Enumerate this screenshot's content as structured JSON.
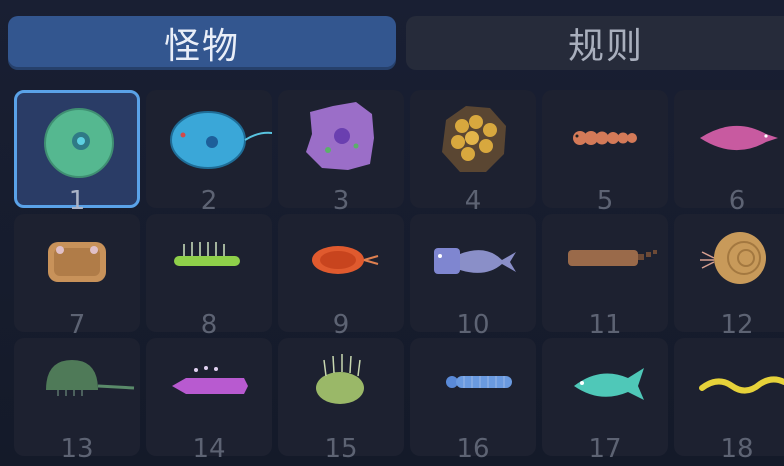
{
  "tabs": {
    "monsters_label": "怪物",
    "rules_label": "规则"
  },
  "cards": [
    {
      "number": "1",
      "icon": "green-cell-icon",
      "selected": true
    },
    {
      "number": "2",
      "icon": "blue-flagellate-icon",
      "selected": false
    },
    {
      "number": "3",
      "icon": "purple-amoeba-icon",
      "selected": false
    },
    {
      "number": "4",
      "icon": "egg-cluster-icon",
      "selected": false
    },
    {
      "number": "5",
      "icon": "segmented-worm-icon",
      "selected": false
    },
    {
      "number": "6",
      "icon": "pink-fish-icon",
      "selected": false
    },
    {
      "number": "7",
      "icon": "trilobite-icon",
      "selected": false
    },
    {
      "number": "8",
      "icon": "spiny-worm-icon",
      "selected": false
    },
    {
      "number": "9",
      "icon": "red-crustacean-icon",
      "selected": false
    },
    {
      "number": "10",
      "icon": "armored-fish-icon",
      "selected": false
    },
    {
      "number": "11",
      "icon": "brown-arthropod-icon",
      "selected": false
    },
    {
      "number": "12",
      "icon": "ammonite-icon",
      "selected": false
    },
    {
      "number": "13",
      "icon": "horseshoe-crab-icon",
      "selected": false
    },
    {
      "number": "14",
      "icon": "magenta-worm-icon",
      "selected": false
    },
    {
      "number": "15",
      "icon": "spiky-blob-icon",
      "selected": false
    },
    {
      "number": "16",
      "icon": "blue-centipede-icon",
      "selected": false
    },
    {
      "number": "17",
      "icon": "teal-fish-icon",
      "selected": false
    },
    {
      "number": "18",
      "icon": "yellow-eel-icon",
      "selected": false
    }
  ],
  "colors": {
    "active_tab": "#33568f",
    "inactive_tab": "#262b3a",
    "selected_border": "#5aa2e8",
    "card_bg": "#1d2130"
  }
}
